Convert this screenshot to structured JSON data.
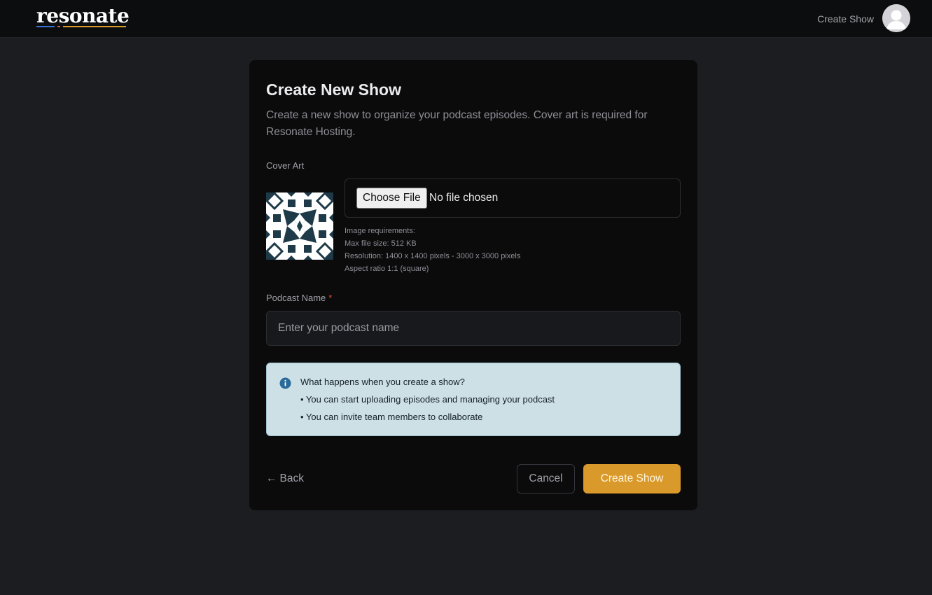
{
  "brand": {
    "logo_text": "resonate",
    "underline_colors": [
      "#3b6fd1",
      "#e0533d",
      "#d99a2b"
    ]
  },
  "nav": {
    "create_show_link": "Create Show",
    "avatar_icon": "user-avatar-icon"
  },
  "form": {
    "title": "Create New Show",
    "description": "Create a new show to organize your podcast episodes. Cover art is required for Resonate Hosting.",
    "cover_art": {
      "label": "Cover Art",
      "thumbnail_icon": "pattern-tile-image",
      "choose_file_label": "Choose File",
      "file_status": "No file chosen",
      "requirements": [
        "Image requirements:",
        "Max file size: 512 KB",
        "Resolution: 1400 x 1400 pixels - 3000 x 3000 pixels",
        "Aspect ratio 1:1 (square)"
      ]
    },
    "podcast_name": {
      "label": "Podcast Name",
      "required_mark": "*",
      "placeholder": "Enter your podcast name",
      "value": ""
    },
    "info": {
      "icon": "info-circle-icon",
      "title": "What happens when you create a show?",
      "items": [
        "• You can start uploading episodes and managing your podcast",
        "• You can invite team members to collaborate"
      ]
    },
    "actions": {
      "back_arrow": "←",
      "back_label": "Back",
      "cancel_label": "Cancel",
      "submit_label": "Create Show"
    }
  },
  "colors": {
    "accent": "#d99a2b",
    "background": "#1c1d21",
    "card": "#0b0b0c",
    "info_bg": "#cde0e6"
  }
}
